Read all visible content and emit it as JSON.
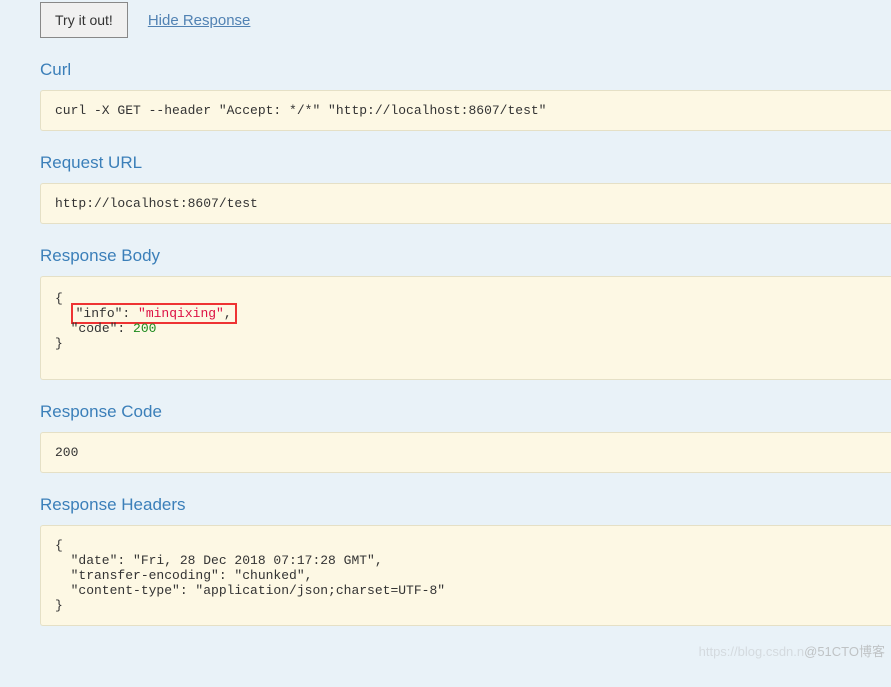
{
  "actions": {
    "try_label": "Try it out!",
    "hide_label": "Hide Response"
  },
  "sections": {
    "curl": {
      "title": "Curl",
      "content": "curl -X GET --header \"Accept: */*\" \"http://localhost:8607/test\""
    },
    "request_url": {
      "title": "Request URL",
      "content": "http://localhost:8607/test"
    },
    "response_body": {
      "title": "Response Body",
      "json": {
        "open": "{",
        "info_key": "\"info\"",
        "info_val": "\"minqixing\"",
        "code_key": "\"code\"",
        "code_val": "200",
        "close": "}"
      }
    },
    "response_code": {
      "title": "Response Code",
      "content": "200"
    },
    "response_headers": {
      "title": "Response Headers",
      "content": "{\n  \"date\": \"Fri, 28 Dec 2018 07:17:28 GMT\",\n  \"transfer-encoding\": \"chunked\",\n  \"content-type\": \"application/json;charset=UTF-8\"\n}"
    }
  },
  "watermark": {
    "faint": "https://blog.csdn.n",
    "main": "@51CTO博客"
  }
}
